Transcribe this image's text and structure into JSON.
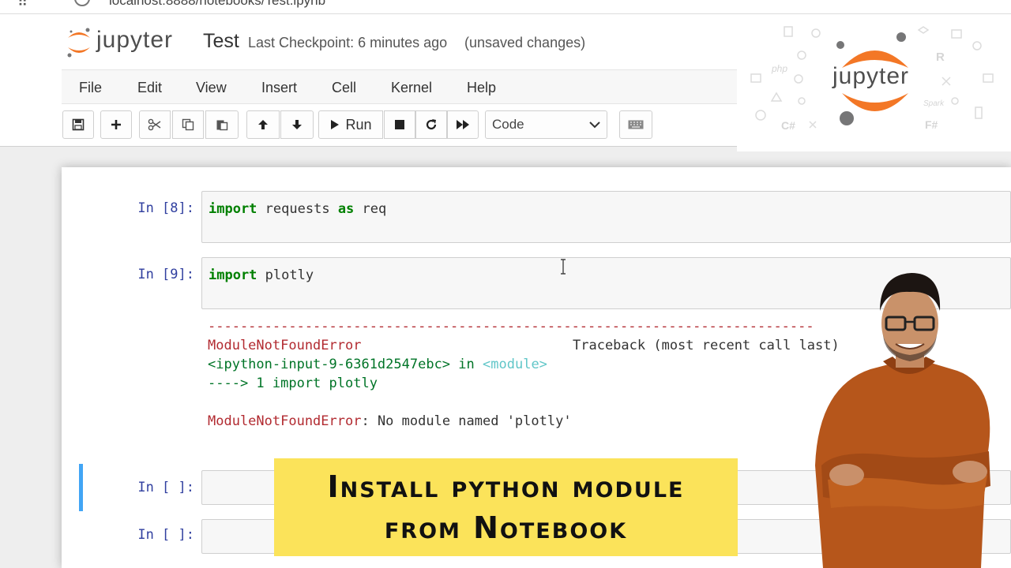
{
  "browser": {
    "url": "localhost:8888/notebooks/Test.ipynb"
  },
  "header": {
    "logo_text": "jupyter",
    "notebook_name": "Test",
    "checkpoint": "Last Checkpoint: 6 minutes ago",
    "save_status": "(unsaved changes)"
  },
  "menu": {
    "items": [
      "File",
      "Edit",
      "View",
      "Insert",
      "Cell",
      "Kernel",
      "Help"
    ]
  },
  "toolbar": {
    "buttons": [
      {
        "name": "save-icon"
      },
      {
        "name": "plus-icon"
      },
      {
        "name": "scissors-icon"
      },
      {
        "name": "copy-icon"
      },
      {
        "name": "paste-icon"
      },
      {
        "name": "arrow-up-icon"
      },
      {
        "name": "arrow-down-icon"
      },
      {
        "name": "run-icon"
      },
      {
        "name": "stop-icon"
      },
      {
        "name": "restart-icon"
      },
      {
        "name": "fast-forward-icon"
      },
      {
        "name": "keyboard-icon"
      }
    ],
    "run_label": "Run",
    "cell_type": "Code"
  },
  "cells": [
    {
      "prompt": "In [8]:",
      "keyword1": "import",
      "text1": "requests",
      "keyword2": "as",
      "text2": "req"
    },
    {
      "prompt": "In [9]:",
      "keyword1": "import",
      "text1": "plotly"
    },
    {
      "prompt": "In [ ]:"
    },
    {
      "prompt": "In [ ]:"
    }
  ],
  "error_output": {
    "divider": "---------------------------------------------------------------------------",
    "error_name": "ModuleNotFoundError",
    "traceback_label": "Traceback (most recent call last)",
    "location": "<ipython-input-9-6361d2547ebc>",
    "in_word": "in",
    "module_tag": "<module>",
    "arrow_line": "----> 1 import plotly",
    "message_name": "ModuleNotFoundError",
    "message": ": No module named 'plotly'"
  },
  "logo_panel": {
    "logo_text": "jupyter",
    "deco_labels": [
      "php",
      "C#",
      "F#",
      "R",
      "Spark"
    ]
  },
  "banner": {
    "line1": "Install python module",
    "line2": "from Notebook"
  },
  "colors": {
    "jupyter_orange": "#f37726",
    "prompt_blue": "#303f9f",
    "keyword_green": "#008000",
    "error_red": "#b22b31",
    "banner_yellow": "#fbe35a",
    "selected_cell_blue": "#42a5f5"
  }
}
